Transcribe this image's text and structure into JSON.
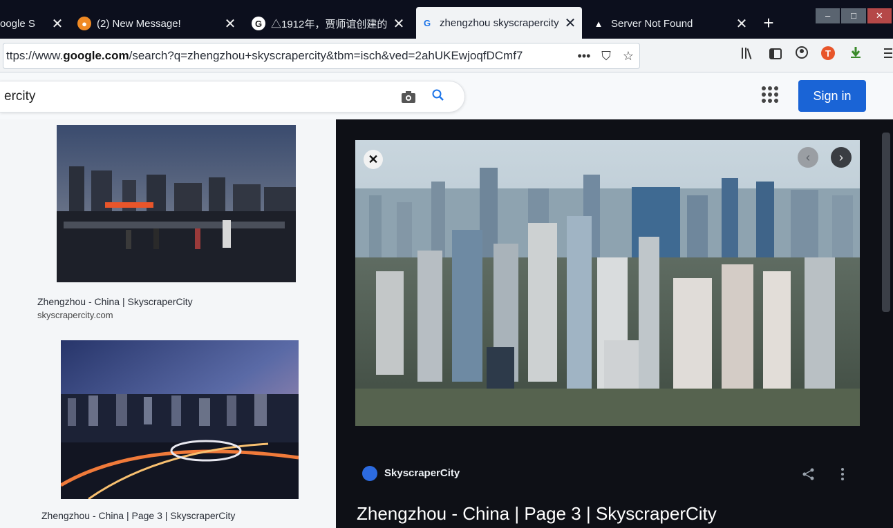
{
  "tabs": [
    {
      "title": "oogle S",
      "favicon": "google-g"
    },
    {
      "title": "(2) New Message!",
      "favicon": "message"
    },
    {
      "title": "△1912年，贾师谊创建的",
      "favicon": "g-logo"
    },
    {
      "title": "zhengzhou skyscrapercity",
      "favicon": "google-g"
    },
    {
      "title": "Server Not Found",
      "favicon": "warning"
    }
  ],
  "new_tab": "+",
  "tab_close": "✕",
  "url": {
    "prefix": "ttps://www.",
    "domain": "google.com",
    "rest": "/search?q=zhengzhou+skyscrapercity&tbm=isch&ved=2ahUKEwjoqfDCmf7"
  },
  "url_actions": {
    "more": "•••",
    "pocket": "⛉",
    "bookmark": "☆"
  },
  "toolbar_icons": [
    "library-icon",
    "sidebar-icon",
    "account-icon",
    "extension-t-icon",
    "download-icon",
    "menu-icon"
  ],
  "search": {
    "query": "ercity"
  },
  "signin_label": "Sign in",
  "results": [
    {
      "caption": "Zhengzhou - China | SkyscraperCity",
      "source": "skyscrapercity.com"
    },
    {
      "caption": "Zhengzhou - China | Page 3 | SkyscraperCity",
      "source": ""
    }
  ],
  "viewer": {
    "site": "SkyscraperCity",
    "title": "Zhengzhou - China | Page 3 | SkyscraperCity",
    "close": "✕",
    "prev": "‹",
    "next": "›"
  },
  "colors": {
    "accent": "#1a64d6",
    "tabbar": "#0c0f1d",
    "viewer": "#0e1016"
  }
}
